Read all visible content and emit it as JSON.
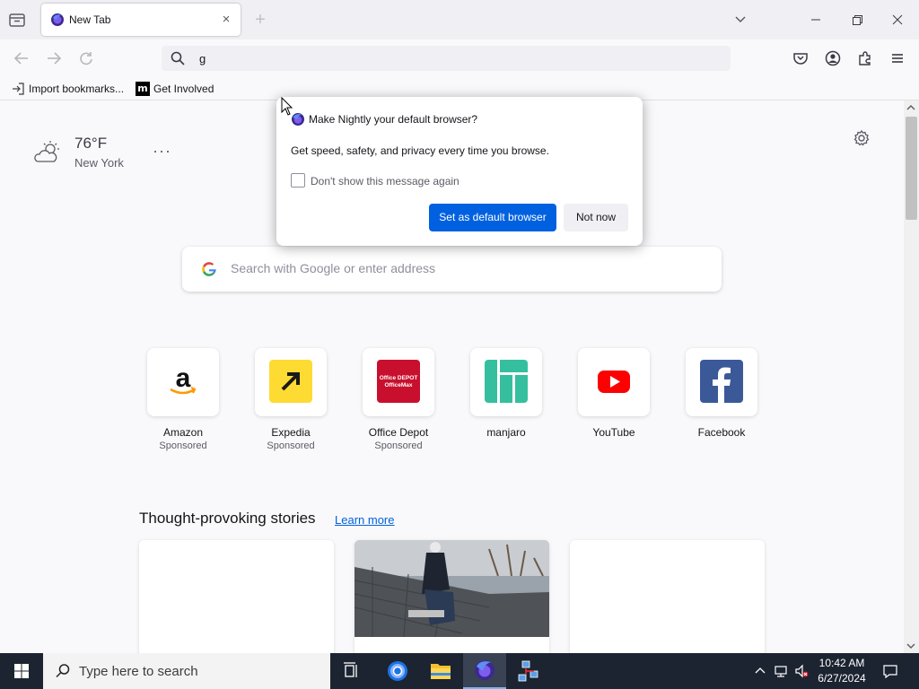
{
  "browser": {
    "tab": {
      "title": "New Tab",
      "close_glyph": "×"
    },
    "new_tab_glyph": "+",
    "urlbar": {
      "value": "g"
    },
    "bookmarks": [
      {
        "label": "Import bookmarks...",
        "icon": "import-icon"
      },
      {
        "label": "Get Involved",
        "icon": "mdn-icon",
        "icon_text": "m"
      }
    ]
  },
  "newtab": {
    "weather": {
      "temp": "76°F",
      "city": "New York",
      "more": "···"
    },
    "search_placeholder": "Search with Google or enter address",
    "topsites": [
      {
        "label": "Amazon",
        "sponsored": "Sponsored"
      },
      {
        "label": "Expedia",
        "sponsored": "Sponsored"
      },
      {
        "label": "Office Depot",
        "sponsored": "Sponsored",
        "logo_text": "Office DEPOT OfficeMax"
      },
      {
        "label": "manjaro",
        "sponsored": ""
      },
      {
        "label": "YouTube",
        "sponsored": ""
      },
      {
        "label": "Facebook",
        "sponsored": ""
      }
    ],
    "stories": {
      "title": "Thought-provoking stories",
      "link": "Learn more"
    }
  },
  "dialog": {
    "title": "Make Nightly your default browser?",
    "message": "Get speed, safety, and privacy every time you browse.",
    "checkbox_label": "Don't show this message again",
    "primary_button": "Set as default browser",
    "secondary_button": "Not now"
  },
  "taskbar": {
    "search_placeholder": "Type here to search",
    "time": "10:42 AM",
    "date": "6/27/2024"
  },
  "colors": {
    "accent": "#0061e0",
    "taskbar": "#1c2431"
  }
}
